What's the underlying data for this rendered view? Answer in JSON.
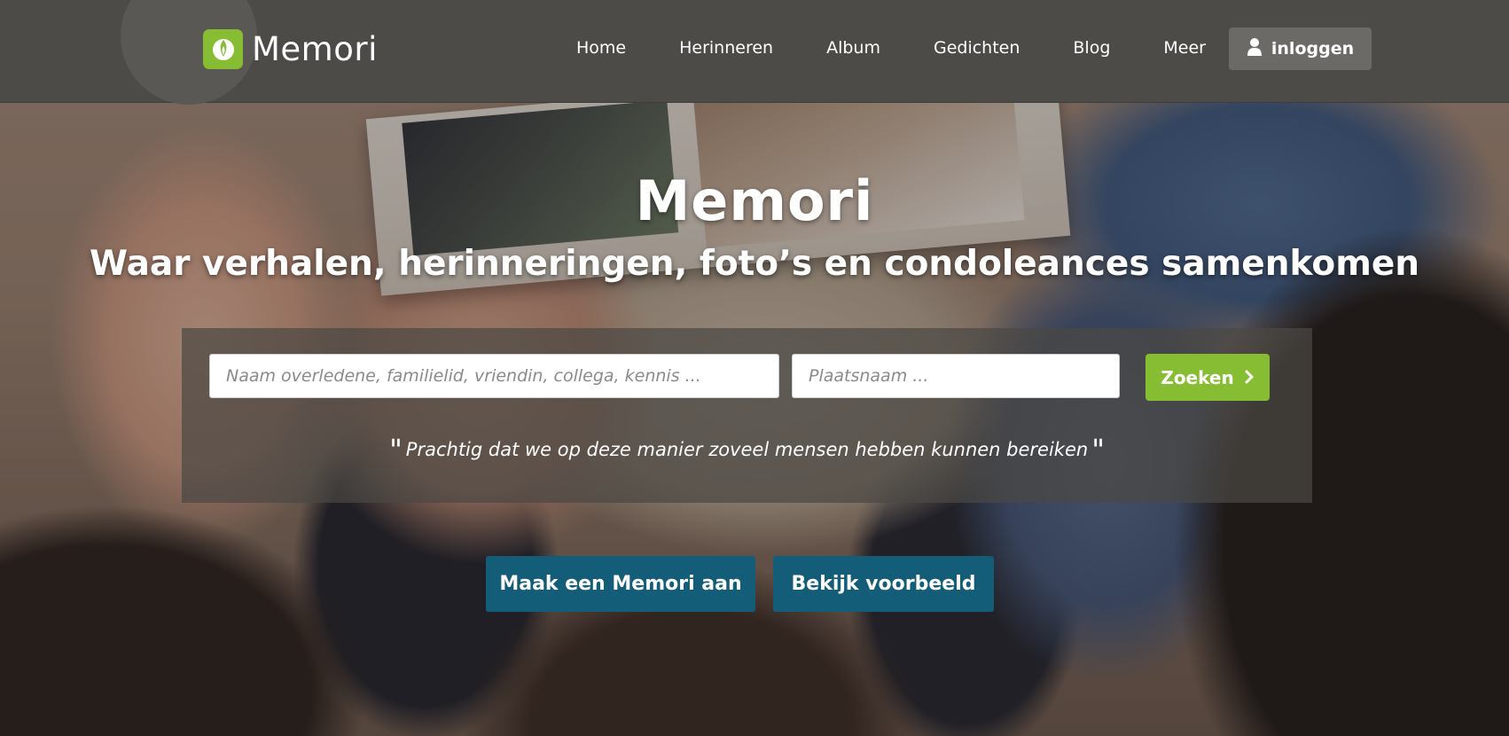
{
  "brand": {
    "name": "Memori",
    "accent_color": "#86bd33",
    "header_color": "#4d4b47",
    "cta_color": "#145d78"
  },
  "nav": {
    "items": [
      {
        "label": "Home"
      },
      {
        "label": "Herinneren"
      },
      {
        "label": "Album"
      },
      {
        "label": "Gedichten"
      },
      {
        "label": "Blog"
      },
      {
        "label": "Meer"
      }
    ],
    "login_label": "inloggen",
    "login_icon": "user-icon"
  },
  "hero": {
    "title": "Memori",
    "subtitle": "Waar verhalen, herinneringen, foto’s en condoleances samenkomen",
    "quote": "Prachtig dat we op deze manier zoveel mensen hebben kunnen bereiken"
  },
  "search": {
    "name_placeholder": "Naam overledene, familielid, vriendin, collega, kennis ...",
    "place_placeholder": "Plaatsnaam ...",
    "button_label": "Zoeken",
    "button_icon": "chevron-right-icon"
  },
  "cta": {
    "create_label": "Maak een Memori aan",
    "example_label": "Bekijk voorbeeld"
  }
}
